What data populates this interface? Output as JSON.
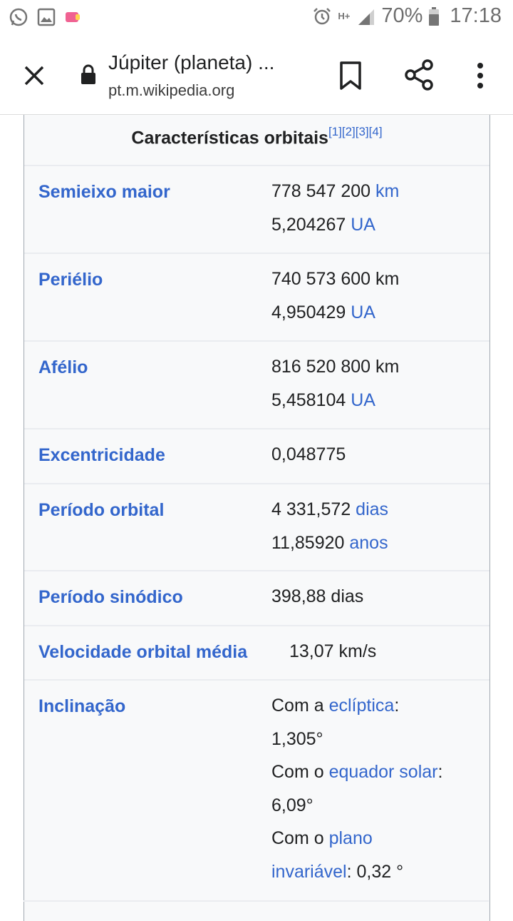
{
  "status_bar": {
    "battery": "70%",
    "time": "17:18",
    "network": "H+"
  },
  "toolbar": {
    "title": "Júpiter (planeta) ...",
    "url": "pt.m.wikipedia.org"
  },
  "infobox": {
    "heading": "Características orbitais",
    "refs": "[1][2][3][4]",
    "rows": [
      {
        "label": "Semieixo maior",
        "line1_num": "778 547 200 ",
        "line1_unit": "km",
        "line2_num": "5,204267 ",
        "line2_unit": "UA"
      },
      {
        "label": "Periélio",
        "line1_num": "740 573 600 km",
        "line2_num": "4,950429 ",
        "line2_unit": "UA"
      },
      {
        "label": "Afélio",
        "line1_num": "816 520 800 km",
        "line2_num": "5,458104 ",
        "line2_unit": "UA"
      },
      {
        "label": "Excentricidade",
        "value": "0,048775"
      },
      {
        "label": "Período orbital",
        "line1_num": "4 331,572 ",
        "line1_unit": "dias",
        "line2_num": "11,85920 ",
        "line2_unit": "anos"
      },
      {
        "label": "Período sinódico",
        "value": "398,88 dias"
      },
      {
        "label": "Velocidade orbital média",
        "value": "13,07 km/s"
      },
      {
        "label": "Inclinação",
        "l1a": "Com a ",
        "l1link": "eclíptica",
        "l1b": ":",
        "l2": "1,305°",
        "l3a": "Com o ",
        "l3link": "equador solar",
        "l3b": ":",
        "l4": "6,09°",
        "l5a": "Com o ",
        "l5link": "plano",
        "l6link": "invariável",
        "l6b": ": 0,32 °"
      }
    ]
  }
}
